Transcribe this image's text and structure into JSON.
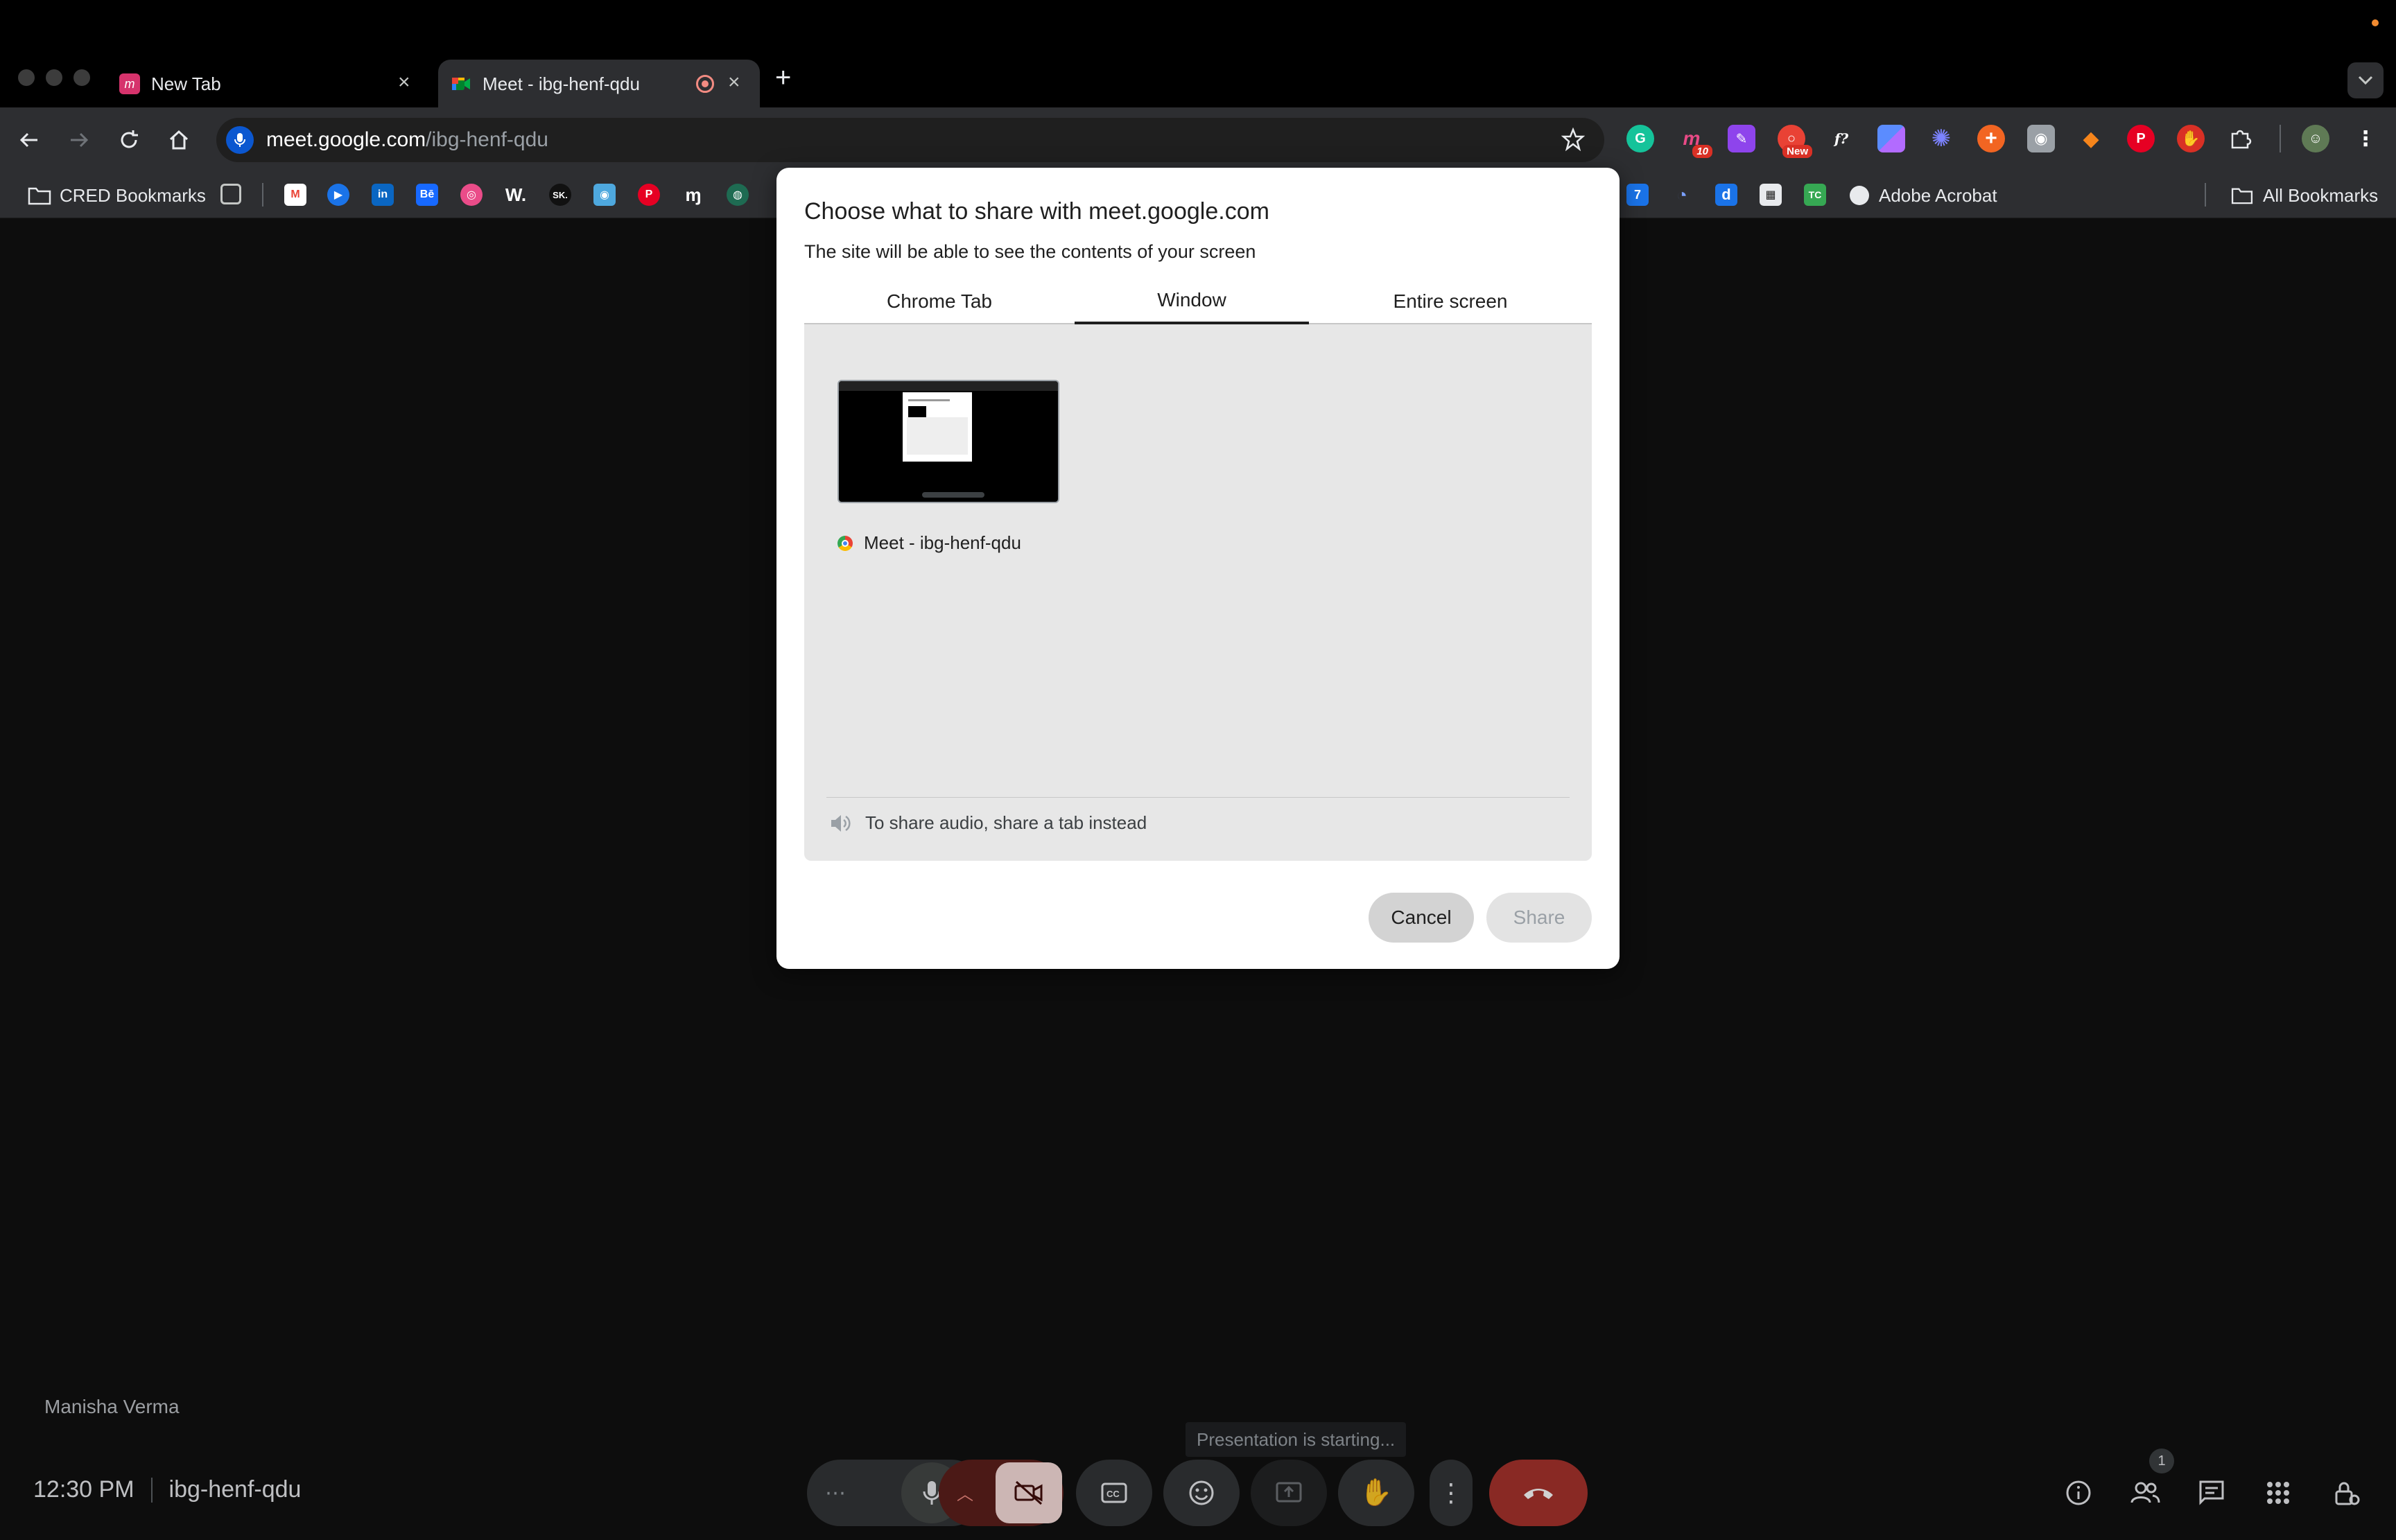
{
  "browser": {
    "tabs": [
      {
        "title": "New Tab",
        "active": false
      },
      {
        "title": "Meet - ibg-henf-qdu",
        "active": true
      }
    ],
    "url": {
      "host": "meet.google.com",
      "path": "/ibg-henf-qdu"
    },
    "extensions": [
      {
        "icon": "grammarly-icon"
      },
      {
        "icon": "m-extension-icon",
        "badge": "10"
      },
      {
        "icon": "purple-extension-icon"
      },
      {
        "icon": "red-extension-icon",
        "badge": "New"
      },
      {
        "icon": "formula-icon",
        "text": "f?"
      },
      {
        "icon": "tiles-extension-icon"
      },
      {
        "icon": "gear-extension-icon"
      },
      {
        "icon": "plus-extension-icon"
      },
      {
        "icon": "camera-extension-icon"
      },
      {
        "icon": "fox-extension-icon"
      },
      {
        "icon": "pinterest-extension-icon"
      },
      {
        "icon": "hand-extension-icon"
      },
      {
        "icon": "puzzle-icon"
      },
      {
        "icon": "profile-avatar"
      }
    ],
    "bookmarks": {
      "cred": "CRED Bookmarks",
      "adobe": "Adobe Acrobat",
      "all": "All Bookmarks"
    }
  },
  "dialog": {
    "title": "Choose what to share with meet.google.com",
    "subtitle": "The site will be able to see the contents of your screen",
    "tabs": [
      "Chrome Tab",
      "Window",
      "Entire screen"
    ],
    "active_tab": "Window",
    "windows": [
      {
        "label": "Meet - ibg-henf-qdu"
      }
    ],
    "audio_note": "To share audio, share a tab instead",
    "cancel": "Cancel",
    "share": "Share"
  },
  "meet": {
    "participant_name": "Manisha Verma",
    "toast": "Presentation is starting...",
    "time": "12:30 PM",
    "meeting_code": "ibg-henf-qdu",
    "people_count": "1"
  },
  "colors": {
    "end_call": "#a8322d",
    "camera_off": "#f9dedc",
    "accent": "#0b57d0"
  }
}
